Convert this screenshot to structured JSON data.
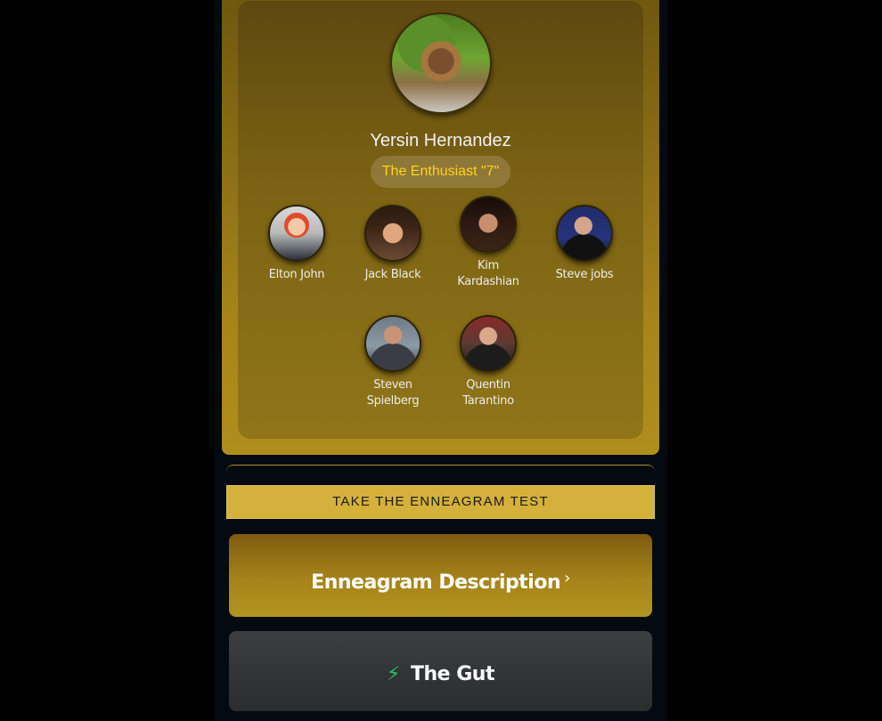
{
  "profile": {
    "name": "Yersin Hernandez",
    "type_label": "The Enthusiast \"7\""
  },
  "celebrities": [
    {
      "name": "Elton John"
    },
    {
      "name": "Jack Black"
    },
    {
      "name": "Kim Kardashian"
    },
    {
      "name": "Steve jobs"
    },
    {
      "name": "Steven Spielberg"
    },
    {
      "name": "Quentin Tarantino"
    }
  ],
  "actions": {
    "test_button": "TAKE THE ENNEAGRAM TEST",
    "description_card": "Enneagram Description",
    "description_chevron": "›",
    "gut_card": "The Gut",
    "gut_icon": "⚡"
  },
  "colors": {
    "accent": "#d4b13a",
    "badge_text": "#ffd21f",
    "bolt": "#27c46b"
  }
}
